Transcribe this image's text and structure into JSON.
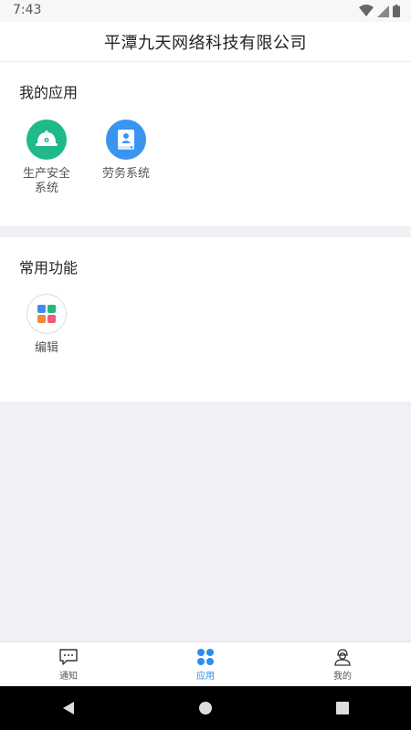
{
  "status_bar": {
    "time": "7:43",
    "icons": [
      "wifi-icon",
      "signal-icon",
      "battery-icon"
    ]
  },
  "header": {
    "title": "平潭九天网络科技有限公司"
  },
  "my_apps": {
    "title": "我的应用",
    "items": [
      {
        "label": "生产安全系统",
        "icon": "hard-hat-icon",
        "color": "#1fb98a"
      },
      {
        "label": "劳务系统",
        "icon": "worker-badge-icon",
        "color": "#3a95f0"
      }
    ]
  },
  "common_functions": {
    "title": "常用功能",
    "items": [
      {
        "label": "编辑",
        "icon": "edit-grid-icon",
        "colors": [
          "#3a8ef0",
          "#22b67a",
          "#f08a3a",
          "#ef5b78"
        ]
      }
    ]
  },
  "tab_bar": {
    "active": "应用",
    "active_color": "#2e8cf0",
    "tabs": [
      {
        "label": "通知",
        "icon": "chat-bubble-icon"
      },
      {
        "label": "应用",
        "icon": "apps-grid-icon"
      },
      {
        "label": "我的",
        "icon": "user-profile-icon"
      }
    ]
  },
  "nav_bar": {
    "buttons": [
      "back-icon",
      "home-icon",
      "recents-icon"
    ]
  }
}
